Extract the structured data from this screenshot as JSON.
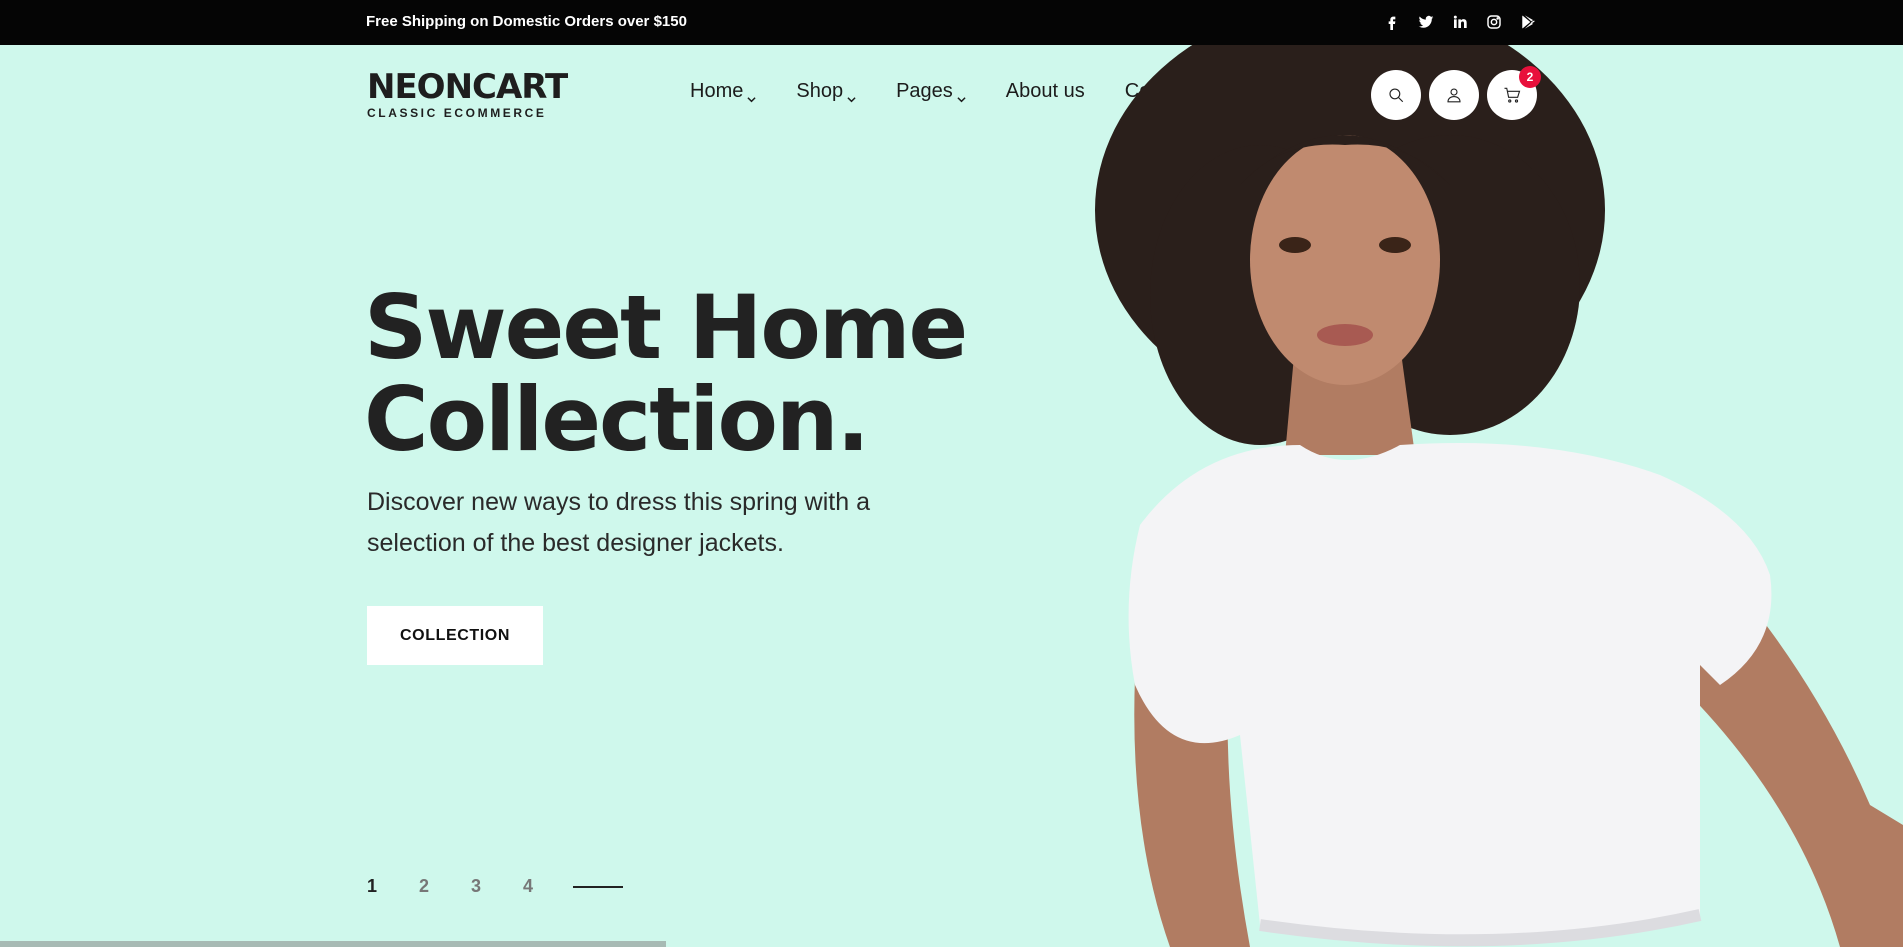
{
  "topbar": {
    "promo": "Free Shipping on Domestic Orders over $150",
    "socials": [
      "facebook-icon",
      "twitter-icon",
      "linkedin-icon",
      "instagram-icon",
      "google-play-icon"
    ]
  },
  "logo": {
    "wordmark": "NEONCART",
    "tagline": "CLASSIC ECOMMERCE"
  },
  "nav": {
    "items": [
      {
        "label": "Home",
        "dropdown": true
      },
      {
        "label": "Shop",
        "dropdown": true
      },
      {
        "label": "Pages",
        "dropdown": true
      },
      {
        "label": "About us",
        "dropdown": false
      },
      {
        "label": "Contact",
        "dropdown": false
      }
    ]
  },
  "header_icons": {
    "cart_count": "2"
  },
  "hero": {
    "title_line1": "Sweet Home",
    "title_line2": "Collection.",
    "subtitle_line1": "Discover new ways to dress this spring with a",
    "subtitle_line2": "selection of the best designer jackets.",
    "cta_label": "COLLECTION"
  },
  "slider": {
    "pages": [
      "1",
      "2",
      "3",
      "4"
    ],
    "active_page": "1",
    "progress": 0.35
  },
  "colors": {
    "background": "#cff8ec",
    "topbar": "#050505",
    "badge": "#e8103b"
  }
}
